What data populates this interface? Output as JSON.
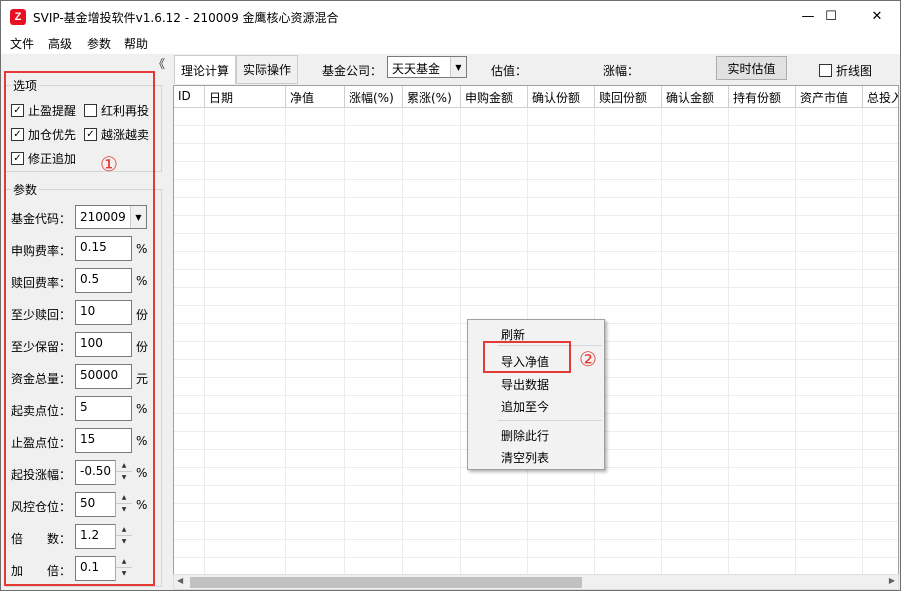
{
  "window": {
    "icon_letter": "Z",
    "title": "SVIP-基金增投软件v1.6.12 - 210009 金鹰核心资源混合",
    "controls": {
      "minimize": "—",
      "maximize": "☐",
      "close": "✕"
    }
  },
  "menu": [
    "文件",
    "高级",
    "参数",
    "帮助"
  ],
  "collapse_glyph": "《",
  "options": {
    "title": "选项",
    "items": [
      {
        "label": "止盈提醒",
        "checked": true,
        "mark": "✓"
      },
      {
        "label": "红利再投",
        "checked": false,
        "mark": ""
      },
      {
        "label": "加仓优先",
        "checked": true,
        "mark": "✓"
      },
      {
        "label": "越涨越卖",
        "checked": true,
        "mark": "✓"
      },
      {
        "label": "修正追加",
        "checked": true,
        "mark": "✓"
      }
    ]
  },
  "params": {
    "title": "参数",
    "fund_code_label": "基金代码：",
    "fund_code": "210009",
    "fields": [
      {
        "label": "申购费率：",
        "value": "0.15",
        "unit": "%"
      },
      {
        "label": "赎回费率：",
        "value": "0.5",
        "unit": "%"
      },
      {
        "label": "至少赎回：",
        "value": "10",
        "unit": "份"
      },
      {
        "label": "至少保留：",
        "value": "100",
        "unit": "份"
      },
      {
        "label": "资金总量：",
        "value": "50000",
        "unit": "元"
      },
      {
        "label": "起卖点位：",
        "value": "5",
        "unit": "%"
      },
      {
        "label": "止盈点位：",
        "value": "15",
        "unit": "%"
      },
      {
        "label": "起投涨幅：",
        "value": "-0.50",
        "unit": "%"
      },
      {
        "label": "风控仓位：",
        "value": "50",
        "unit": "%"
      },
      {
        "label": "倍　　数：",
        "value": "1.2",
        "unit": ""
      },
      {
        "label": "加　　倍：",
        "value": "0.1",
        "unit": ""
      }
    ]
  },
  "annotations": {
    "one": "①",
    "two": "②"
  },
  "toolbar": {
    "tabs": [
      "理论计算",
      "实际操作"
    ],
    "company_label": "基金公司：",
    "company_value": "天天基金",
    "estimate_label": "估值：",
    "change_label": "涨幅：",
    "realtime_button": "实时估值",
    "line_chart_label": "折线图"
  },
  "grid": {
    "columns": [
      "ID",
      "日期",
      "净值",
      "涨幅(%)",
      "累涨(%)",
      "申购金额",
      "确认份额",
      "赎回份额",
      "确认金额",
      "持有份额",
      "资产市值",
      "总投入"
    ]
  },
  "scroll": {
    "left": "◀",
    "right": "▶"
  },
  "context_menu": {
    "items": [
      "刷新",
      "导入净值",
      "导出数据",
      "追加至今",
      "删除此行",
      "清空列表"
    ]
  }
}
